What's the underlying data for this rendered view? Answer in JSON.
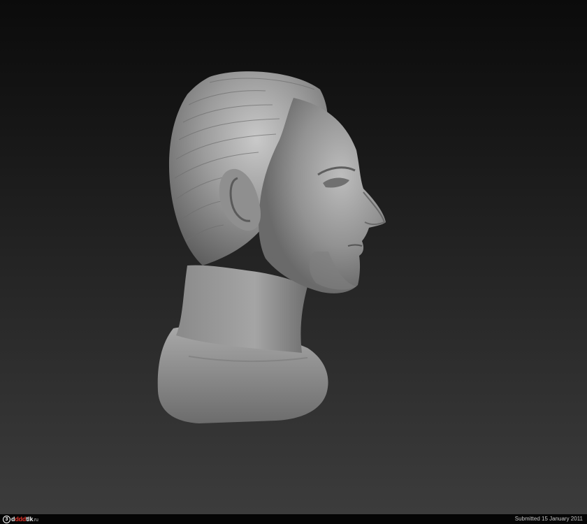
{
  "footer": {
    "logo": {
      "mark": "3",
      "brand_prefix": "d",
      "brand_accent": "ddd",
      "brand_suffix": "tlk",
      "tld": ".ru"
    },
    "submitted_text": "Submitted 15 January 2011"
  },
  "colors": {
    "background_top": "#0b0b0b",
    "background_bottom": "#3c3c3c",
    "clay": "#8e8e8e",
    "footer_bg": "#050505",
    "logo_accent": "#e0342a"
  },
  "icons": [
    "3ddd-logo-icon"
  ]
}
